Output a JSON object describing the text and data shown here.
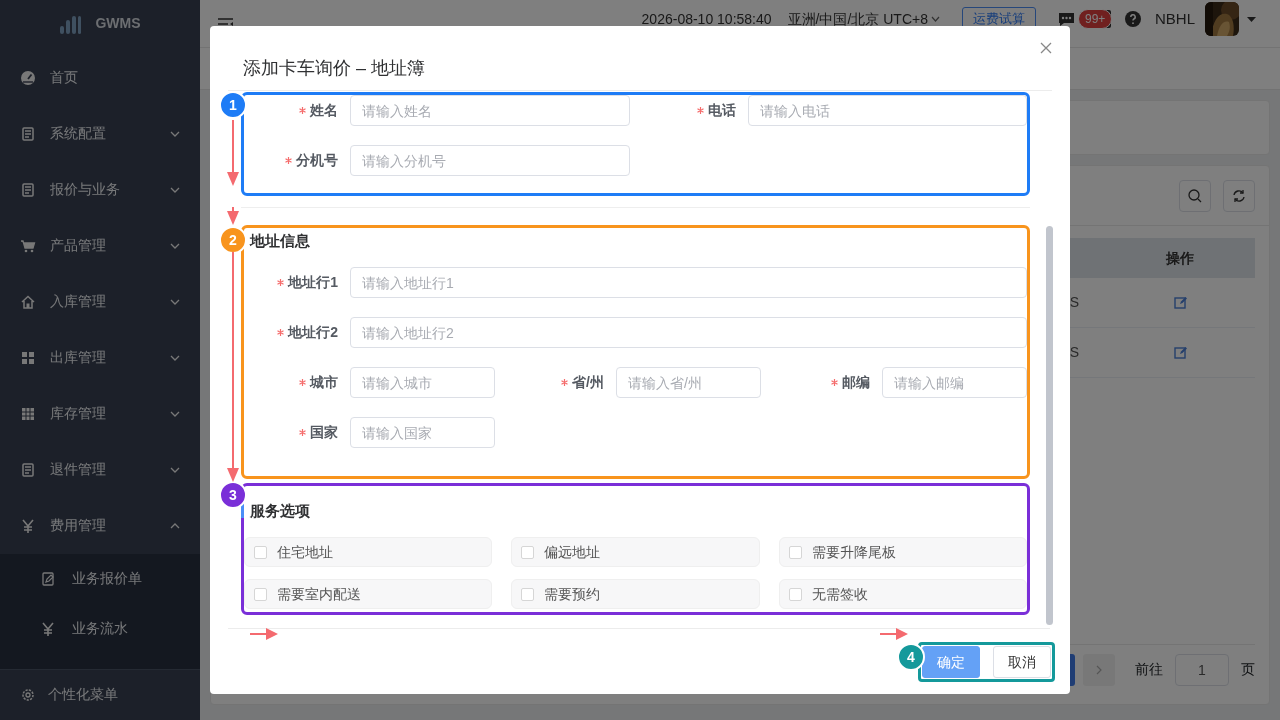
{
  "sidebar": {
    "logo": "GWMS",
    "items": [
      {
        "label": "首页",
        "kind": "link"
      },
      {
        "label": "系统配置",
        "kind": "group",
        "expanded": false
      },
      {
        "label": "报价与业务",
        "kind": "group",
        "expanded": false
      },
      {
        "label": "产品管理",
        "kind": "group",
        "expanded": false
      },
      {
        "label": "入库管理",
        "kind": "group",
        "expanded": false
      },
      {
        "label": "出库管理",
        "kind": "group",
        "expanded": false
      },
      {
        "label": "库存管理",
        "kind": "group",
        "expanded": false
      },
      {
        "label": "退件管理",
        "kind": "group",
        "expanded": false
      },
      {
        "label": "费用管理",
        "kind": "group",
        "expanded": true,
        "children": [
          {
            "label": "业务报价单"
          },
          {
            "label": "业务流水"
          }
        ]
      }
    ],
    "footer": "个性化菜单"
  },
  "header": {
    "datetime": "2026-08-10 10:58:40",
    "timezone": "亚洲/中国/北京 UTC+8",
    "calc_button": "运费试算",
    "notification_badge": "99+",
    "user": "NBHL"
  },
  "table": {
    "columns": [
      "操作"
    ],
    "rows": [
      {
        "column_1": "S"
      },
      {
        "column_1": "S"
      }
    ]
  },
  "pagination": {
    "goto_label": "前往",
    "page": "1",
    "page_suffix": "页"
  },
  "modal": {
    "title": "添加卡车询价 – 地址簿",
    "contact": {
      "marker": {
        "number": "1",
        "color": "#1e7cf6"
      },
      "fields": [
        {
          "label": "姓名",
          "placeholder": "请输入姓名",
          "required": true
        },
        {
          "label": "电话",
          "placeholder": "请输入电话",
          "required": true
        },
        {
          "label": "分机号",
          "placeholder": "请输入分机号",
          "required": true
        }
      ]
    },
    "address": {
      "marker": {
        "number": "2",
        "color": "#f8941d"
      },
      "heading": "地址信息",
      "lines": [
        {
          "label": "地址行1",
          "placeholder": "请输入地址行1",
          "required": true
        },
        {
          "label": "地址行2",
          "placeholder": "请输入地址行2",
          "required": true
        }
      ],
      "fields": [
        {
          "label": "城市",
          "placeholder": "请输入城市",
          "required": true
        },
        {
          "label": "省/州",
          "placeholder": "请输入省/州",
          "required": true
        },
        {
          "label": "邮编",
          "placeholder": "请输入邮编",
          "required": true
        },
        {
          "label": "国家",
          "placeholder": "请输入国家",
          "required": true
        }
      ]
    },
    "services": {
      "marker": {
        "number": "3",
        "color": "#7a2fd8"
      },
      "heading": "服务选项",
      "options": [
        {
          "label": "住宅地址",
          "checked": false
        },
        {
          "label": "偏远地址",
          "checked": false
        },
        {
          "label": "需要升降尾板",
          "checked": false
        },
        {
          "label": "需要室内配送",
          "checked": false
        },
        {
          "label": "需要预约",
          "checked": false
        },
        {
          "label": "无需签收",
          "checked": false
        }
      ]
    },
    "footer": {
      "marker": {
        "number": "4",
        "color": "#14999b"
      },
      "buttons": [
        {
          "label": "确定",
          "kind": "primary"
        },
        {
          "label": "取消",
          "kind": "default"
        }
      ]
    }
  }
}
